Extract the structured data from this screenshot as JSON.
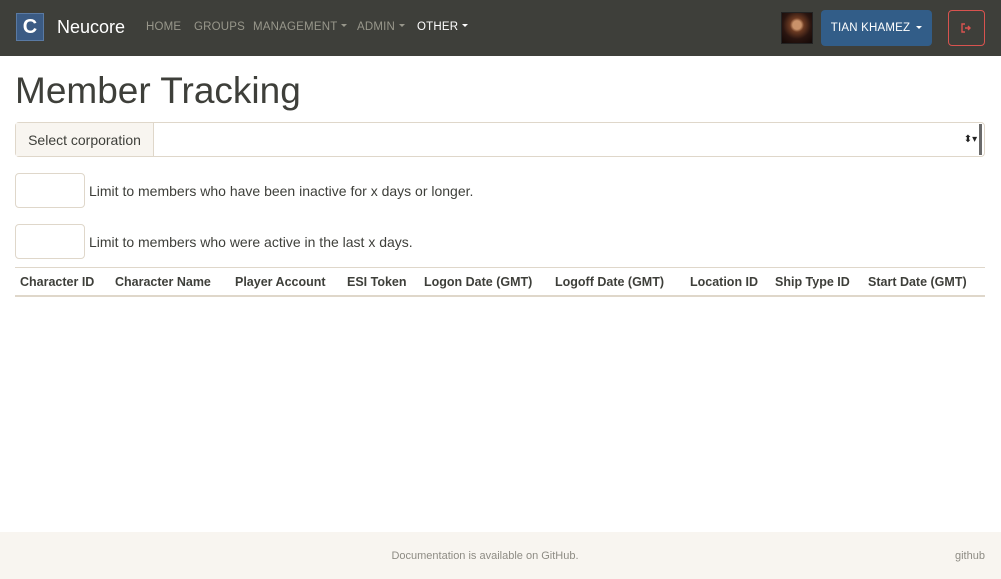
{
  "navbar": {
    "brand_letter": "C",
    "brand_name": "Neucore",
    "items": [
      {
        "label": "HOME"
      },
      {
        "label": "GROUPS"
      },
      {
        "label": "MANAGEMENT"
      },
      {
        "label": "ADMIN"
      },
      {
        "label": "OTHER"
      }
    ],
    "user_label": "TIAN KHAMEZ",
    "logout_icon": "sign-out-icon"
  },
  "page": {
    "title": "Member Tracking",
    "select_label": "Select corporation",
    "select_value": "",
    "inactive_value": "",
    "inactive_label": "Limit to members who have been inactive for x days or longer.",
    "active_value": "",
    "active_label": "Limit to members who were active in the last x days."
  },
  "table": {
    "columns": [
      "Character ID",
      "Character Name",
      "Player Account",
      "ESI Token",
      "Logon Date (GMT)",
      "Logoff Date (GMT)",
      "Location ID",
      "Ship Type ID",
      "Start Date (GMT)"
    ]
  },
  "footer": {
    "text": "Documentation is available on GitHub.",
    "link": "github"
  },
  "colors": {
    "navbar": "#3e3f3a",
    "primary": "#325d88",
    "danger": "#d9534f",
    "footer": "#f8f5f0"
  }
}
